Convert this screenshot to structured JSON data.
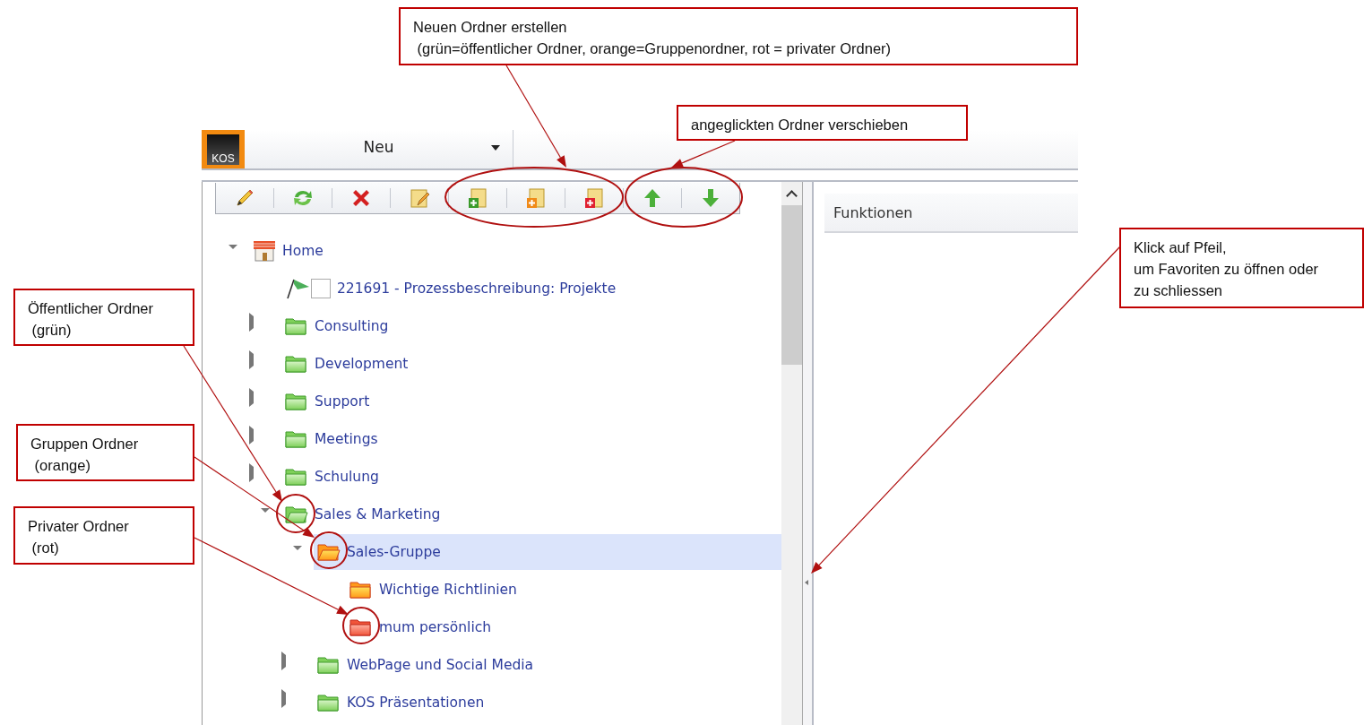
{
  "app": {
    "logo": "KOS",
    "new_menu": {
      "label": "Neu"
    }
  },
  "tree": [
    {
      "label": "Home",
      "kind": "home",
      "expanded": true,
      "selected": false,
      "children": [
        {
          "label": "221691 - Prozessbeschreibung: Projekte",
          "kind": "document",
          "checked": false,
          "selected": false
        },
        {
          "label": "Consulting",
          "kind": "public",
          "expanded": false,
          "selected": false
        },
        {
          "label": "Development",
          "kind": "public",
          "expanded": false,
          "selected": false
        },
        {
          "label": "Support",
          "kind": "public",
          "expanded": false,
          "selected": false
        },
        {
          "label": "Meetings",
          "kind": "public",
          "expanded": false,
          "selected": false
        },
        {
          "label": "Schulung",
          "kind": "public",
          "expanded": false,
          "selected": false
        },
        {
          "label": "Sales & Marketing",
          "kind": "public",
          "expanded": true,
          "selected": false,
          "children": [
            {
              "label": "Sales-Gruppe",
              "kind": "group",
              "expanded": true,
              "selected": true,
              "children": [
                {
                  "label": "Wichtige Richtlinien",
                  "kind": "group",
                  "selected": false
                },
                {
                  "label": "mum persönlich",
                  "kind": "private",
                  "selected": false
                }
              ]
            },
            {
              "label": "WebPage und Social Media",
              "kind": "public",
              "expanded": false,
              "selected": false
            },
            {
              "label": "KOS Präsentationen",
              "kind": "public",
              "expanded": false,
              "selected": false
            }
          ]
        }
      ]
    }
  ],
  "side_panel": {
    "title": "Funktionen"
  },
  "annotations": [
    {
      "text": "Neuen Ordner erstellen\n (grün=öffentlicher Ordner, orange=Gruppenordner, rot = privater Ordner)"
    },
    {
      "text": "angeglickten Ordner verschieben"
    },
    {
      "text": "Klick auf Pfeil,\num Favoriten zu öffnen oder\nzu schliessen"
    },
    {
      "text": "Öffentlicher Ordner\n (grün)"
    },
    {
      "text": "Gruppen Ordner\n (orange)"
    },
    {
      "text": "Privater Ordner\n (rot)"
    }
  ]
}
